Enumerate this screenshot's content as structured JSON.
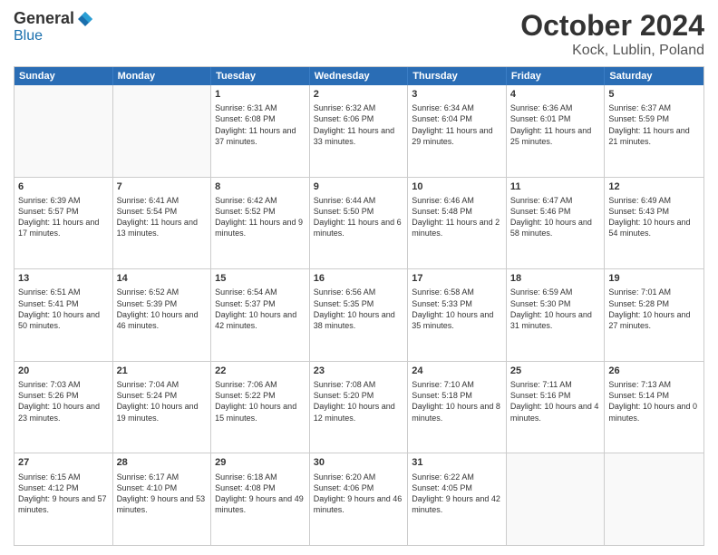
{
  "logo": {
    "general": "General",
    "blue": "Blue"
  },
  "title": "October 2024",
  "location": "Kock, Lublin, Poland",
  "days": [
    "Sunday",
    "Monday",
    "Tuesday",
    "Wednesday",
    "Thursday",
    "Friday",
    "Saturday"
  ],
  "weeks": [
    [
      {
        "day": "",
        "detail": ""
      },
      {
        "day": "",
        "detail": ""
      },
      {
        "day": "1",
        "detail": "Sunrise: 6:31 AM\nSunset: 6:08 PM\nDaylight: 11 hours and 37 minutes."
      },
      {
        "day": "2",
        "detail": "Sunrise: 6:32 AM\nSunset: 6:06 PM\nDaylight: 11 hours and 33 minutes."
      },
      {
        "day": "3",
        "detail": "Sunrise: 6:34 AM\nSunset: 6:04 PM\nDaylight: 11 hours and 29 minutes."
      },
      {
        "day": "4",
        "detail": "Sunrise: 6:36 AM\nSunset: 6:01 PM\nDaylight: 11 hours and 25 minutes."
      },
      {
        "day": "5",
        "detail": "Sunrise: 6:37 AM\nSunset: 5:59 PM\nDaylight: 11 hours and 21 minutes."
      }
    ],
    [
      {
        "day": "6",
        "detail": "Sunrise: 6:39 AM\nSunset: 5:57 PM\nDaylight: 11 hours and 17 minutes."
      },
      {
        "day": "7",
        "detail": "Sunrise: 6:41 AM\nSunset: 5:54 PM\nDaylight: 11 hours and 13 minutes."
      },
      {
        "day": "8",
        "detail": "Sunrise: 6:42 AM\nSunset: 5:52 PM\nDaylight: 11 hours and 9 minutes."
      },
      {
        "day": "9",
        "detail": "Sunrise: 6:44 AM\nSunset: 5:50 PM\nDaylight: 11 hours and 6 minutes."
      },
      {
        "day": "10",
        "detail": "Sunrise: 6:46 AM\nSunset: 5:48 PM\nDaylight: 11 hours and 2 minutes."
      },
      {
        "day": "11",
        "detail": "Sunrise: 6:47 AM\nSunset: 5:46 PM\nDaylight: 10 hours and 58 minutes."
      },
      {
        "day": "12",
        "detail": "Sunrise: 6:49 AM\nSunset: 5:43 PM\nDaylight: 10 hours and 54 minutes."
      }
    ],
    [
      {
        "day": "13",
        "detail": "Sunrise: 6:51 AM\nSunset: 5:41 PM\nDaylight: 10 hours and 50 minutes."
      },
      {
        "day": "14",
        "detail": "Sunrise: 6:52 AM\nSunset: 5:39 PM\nDaylight: 10 hours and 46 minutes."
      },
      {
        "day": "15",
        "detail": "Sunrise: 6:54 AM\nSunset: 5:37 PM\nDaylight: 10 hours and 42 minutes."
      },
      {
        "day": "16",
        "detail": "Sunrise: 6:56 AM\nSunset: 5:35 PM\nDaylight: 10 hours and 38 minutes."
      },
      {
        "day": "17",
        "detail": "Sunrise: 6:58 AM\nSunset: 5:33 PM\nDaylight: 10 hours and 35 minutes."
      },
      {
        "day": "18",
        "detail": "Sunrise: 6:59 AM\nSunset: 5:30 PM\nDaylight: 10 hours and 31 minutes."
      },
      {
        "day": "19",
        "detail": "Sunrise: 7:01 AM\nSunset: 5:28 PM\nDaylight: 10 hours and 27 minutes."
      }
    ],
    [
      {
        "day": "20",
        "detail": "Sunrise: 7:03 AM\nSunset: 5:26 PM\nDaylight: 10 hours and 23 minutes."
      },
      {
        "day": "21",
        "detail": "Sunrise: 7:04 AM\nSunset: 5:24 PM\nDaylight: 10 hours and 19 minutes."
      },
      {
        "day": "22",
        "detail": "Sunrise: 7:06 AM\nSunset: 5:22 PM\nDaylight: 10 hours and 15 minutes."
      },
      {
        "day": "23",
        "detail": "Sunrise: 7:08 AM\nSunset: 5:20 PM\nDaylight: 10 hours and 12 minutes."
      },
      {
        "day": "24",
        "detail": "Sunrise: 7:10 AM\nSunset: 5:18 PM\nDaylight: 10 hours and 8 minutes."
      },
      {
        "day": "25",
        "detail": "Sunrise: 7:11 AM\nSunset: 5:16 PM\nDaylight: 10 hours and 4 minutes."
      },
      {
        "day": "26",
        "detail": "Sunrise: 7:13 AM\nSunset: 5:14 PM\nDaylight: 10 hours and 0 minutes."
      }
    ],
    [
      {
        "day": "27",
        "detail": "Sunrise: 6:15 AM\nSunset: 4:12 PM\nDaylight: 9 hours and 57 minutes."
      },
      {
        "day": "28",
        "detail": "Sunrise: 6:17 AM\nSunset: 4:10 PM\nDaylight: 9 hours and 53 minutes."
      },
      {
        "day": "29",
        "detail": "Sunrise: 6:18 AM\nSunset: 4:08 PM\nDaylight: 9 hours and 49 minutes."
      },
      {
        "day": "30",
        "detail": "Sunrise: 6:20 AM\nSunset: 4:06 PM\nDaylight: 9 hours and 46 minutes."
      },
      {
        "day": "31",
        "detail": "Sunrise: 6:22 AM\nSunset: 4:05 PM\nDaylight: 9 hours and 42 minutes."
      },
      {
        "day": "",
        "detail": ""
      },
      {
        "day": "",
        "detail": ""
      }
    ]
  ]
}
